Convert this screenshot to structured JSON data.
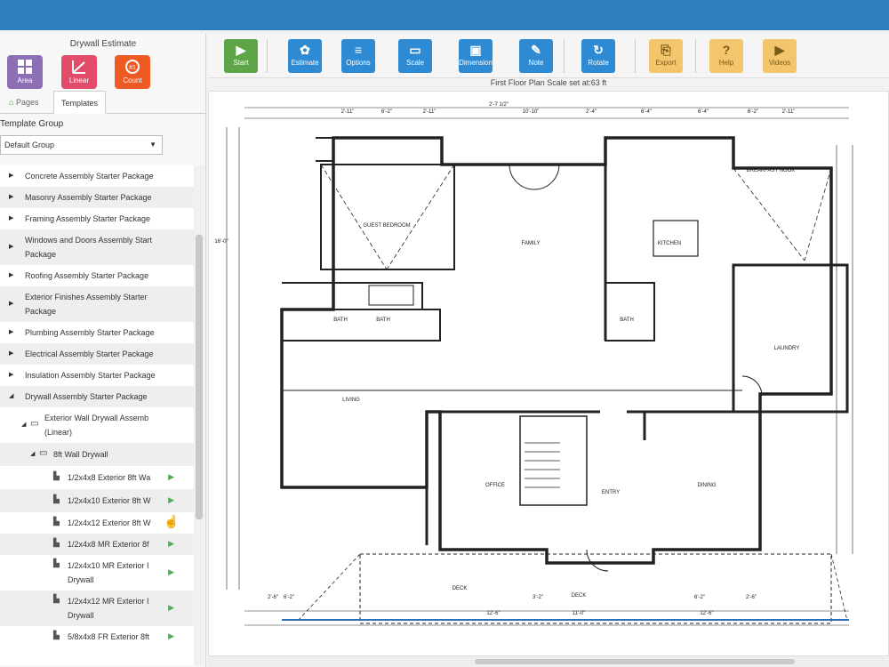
{
  "panel": {
    "title": "Drywall Estimate",
    "modes": [
      {
        "label": "Area",
        "icon": "area-icon",
        "color": "#8d6fb5"
      },
      {
        "label": "Linear",
        "icon": "linear-icon",
        "color": "#e24b6a"
      },
      {
        "label": "Count",
        "icon": "count-icon",
        "color": "#ee5a24"
      }
    ],
    "tabs": {
      "pages": "Pages",
      "templates": "Templates"
    },
    "template_group_label": "Template Group",
    "template_group_value": "Default Group",
    "tree": [
      {
        "label": "Concrete Assembly Starter Package"
      },
      {
        "label": "Masonry Assembly Starter Package"
      },
      {
        "label": "Framing Assembly Starter Package"
      },
      {
        "label": "Windows and Doors Assembly Start",
        "label2": "Package"
      },
      {
        "label": "Roofing Assembly Starter Package"
      },
      {
        "label": "Exterior Finishes Assembly Starter",
        "label2": "Package"
      },
      {
        "label": "Plumbing Assembly Starter Package"
      },
      {
        "label": "Electrical Assembly Starter Package"
      },
      {
        "label": "Insulation Assembly Starter Package"
      },
      {
        "label": "Drywall Assembly Starter Package"
      },
      {
        "label": "Exterior Wall Drywall Assemb",
        "label2": "(Linear)"
      },
      {
        "label": "8ft Wall Drywall"
      },
      {
        "label": "1/2x4x8 Exterior 8ft Wa"
      },
      {
        "label": "1/2x4x10 Exterior 8ft W"
      },
      {
        "label": "1/2x4x12 Exterior 8ft W"
      },
      {
        "label": "1/2x4x8 MR Exterior 8f"
      },
      {
        "label": "1/2x4x10 MR Exterior I",
        "label2": "Drywall"
      },
      {
        "label": "1/2x4x12 MR Exterior I",
        "label2": "Drywall"
      },
      {
        "label": "5/8x4x8 FR Exterior 8ft"
      }
    ]
  },
  "toolbar": {
    "buttons": [
      {
        "label": "Start",
        "icon": "play-icon"
      },
      {
        "label": "Estimate",
        "icon": "estimate-icon"
      },
      {
        "label": "Options",
        "icon": "menu-icon"
      },
      {
        "label": "Scale",
        "icon": "ruler-icon"
      },
      {
        "label": "Dimension",
        "icon": "dimension-icon"
      },
      {
        "label": "Note",
        "icon": "note-icon"
      },
      {
        "label": "Rotate",
        "icon": "rotate-icon"
      },
      {
        "label": "Export",
        "icon": "export-icon"
      },
      {
        "label": "Help",
        "icon": "help-icon"
      },
      {
        "label": "Videos",
        "icon": "video-icon"
      }
    ]
  },
  "plan": {
    "title": "First Floor Plan Scale set at:63 ft",
    "rooms": [
      "GUEST BEDROOM",
      "FAMILY",
      "KITCHEN",
      "BREAKFAST NOOK",
      "BATH",
      "BATH",
      "BATH",
      "LAUNDRY",
      "LIVING",
      "OFFICE",
      "ENTRY",
      "DINING",
      "DECK",
      "DECK"
    ],
    "dims": [
      "2'-11\"",
      "6'-2\"",
      "2'-11\"",
      "2'-7 1/2\"",
      "10'-10\"",
      "2'-4\"",
      "6'-4\"",
      "6'-4\"",
      "6'-2\"",
      "2'-11\"",
      "16'-0\"",
      "6'-2\"",
      "12'-6\"",
      "11'-0\"",
      "12'-6\"",
      "2'-6\"",
      "3'-2\"",
      "6'-2\"",
      "2'-6\""
    ]
  }
}
